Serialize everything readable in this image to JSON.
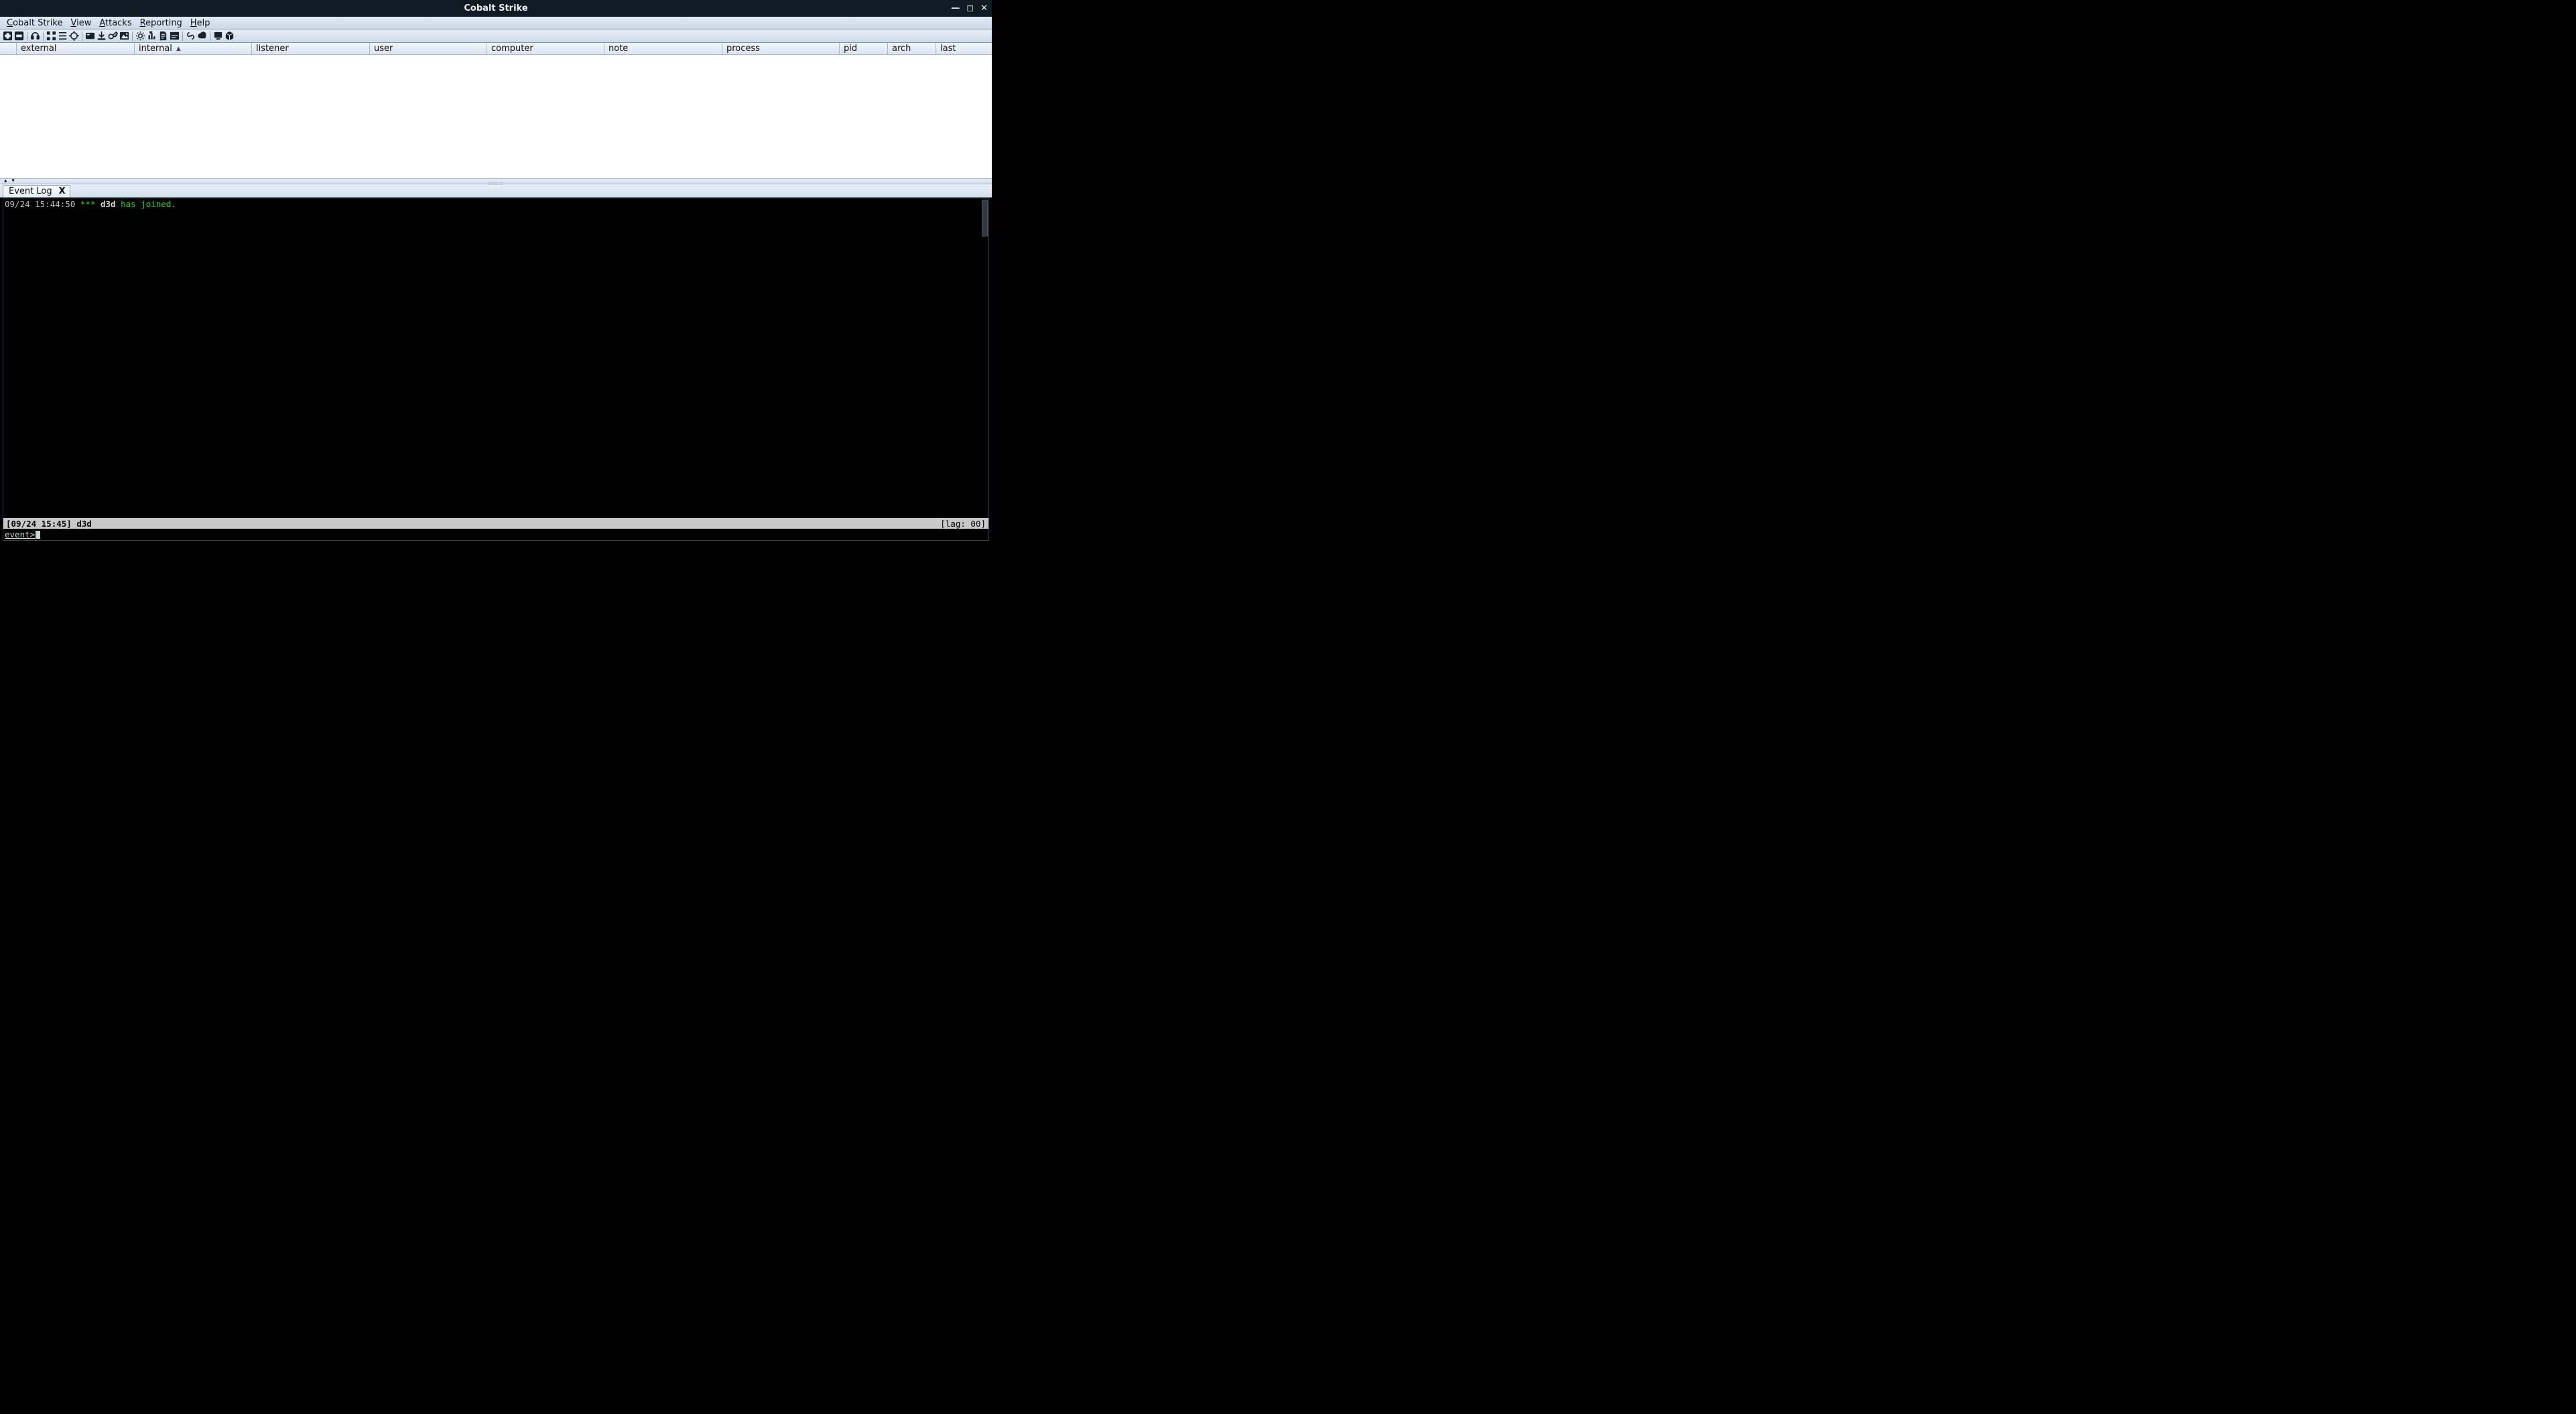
{
  "window": {
    "title": "Cobalt Strike"
  },
  "menu": {
    "items": [
      {
        "label": "Cobalt Strike",
        "ul": "C"
      },
      {
        "label": "View",
        "ul": "V"
      },
      {
        "label": "Attacks",
        "ul": "A"
      },
      {
        "label": "Reporting",
        "ul": "R"
      },
      {
        "label": "Help",
        "ul": "H"
      }
    ]
  },
  "toolbar": {
    "buttons": [
      "connect",
      "disconnect",
      "",
      "listeners",
      "",
      "pivot-graph",
      "session-table",
      "target-table",
      "",
      "credentials",
      "downloads",
      "keystrokes",
      "screenshots",
      "",
      "scripted-web",
      "manage-web",
      "host-file",
      "clone-site",
      "",
      "web-log",
      "web-drive-by",
      "",
      "java-applet",
      "powershell"
    ]
  },
  "session_table": {
    "columns": [
      {
        "key": "external",
        "label": "external",
        "w": 176
      },
      {
        "key": "internal",
        "label": "internal",
        "w": 175,
        "sorted_asc": true
      },
      {
        "key": "listener",
        "label": "listener",
        "w": 176
      },
      {
        "key": "user",
        "label": "user",
        "w": 175
      },
      {
        "key": "computer",
        "label": "computer",
        "w": 175
      },
      {
        "key": "note",
        "label": "note",
        "w": 176
      },
      {
        "key": "process",
        "label": "process",
        "w": 175
      },
      {
        "key": "pid",
        "label": "pid",
        "w": 72
      },
      {
        "key": "arch",
        "label": "arch",
        "w": 72
      },
      {
        "key": "last",
        "label": "last",
        "w": 75
      }
    ]
  },
  "tabs": {
    "items": [
      {
        "label": "Event Log",
        "close": "X"
      }
    ]
  },
  "console": {
    "log_line": {
      "timestamp": "09/24 15:44:50",
      "stars": "***",
      "nick": "d3d",
      "action": "has joined."
    },
    "status": {
      "left_ts": "[09/24 15:45]",
      "left_nick": "d3d",
      "right": "[lag: 00]"
    },
    "prompt": "event>"
  }
}
